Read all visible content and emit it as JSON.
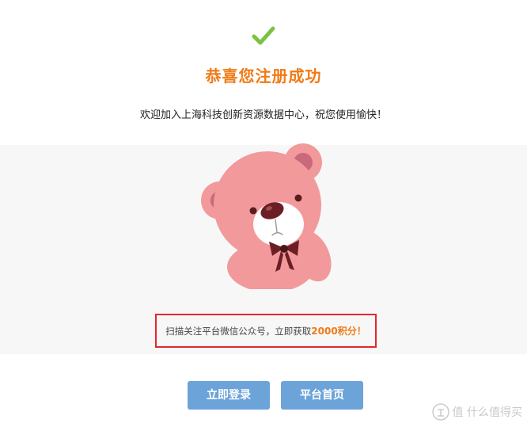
{
  "success": {
    "title": "恭喜您注册成功",
    "welcome_message": "欢迎加入上海科技创新资源数据中心，祝您使用愉快！"
  },
  "promo": {
    "text": "扫描关注平台微信公众号，立即获取",
    "highlight": "2000积分！"
  },
  "buttons": {
    "login": "立即登录",
    "home": "平台首页"
  },
  "watermark": {
    "text": "值 什么值得买"
  },
  "icons": {
    "check": "check-icon",
    "mascot": "teddy-bear-illustration"
  },
  "colors": {
    "accent_orange": "#f07a16",
    "check_green": "#7cc242",
    "button_blue": "#6ca3d9",
    "promo_border_red": "#e0282e",
    "bear_pink": "#f2999b"
  }
}
